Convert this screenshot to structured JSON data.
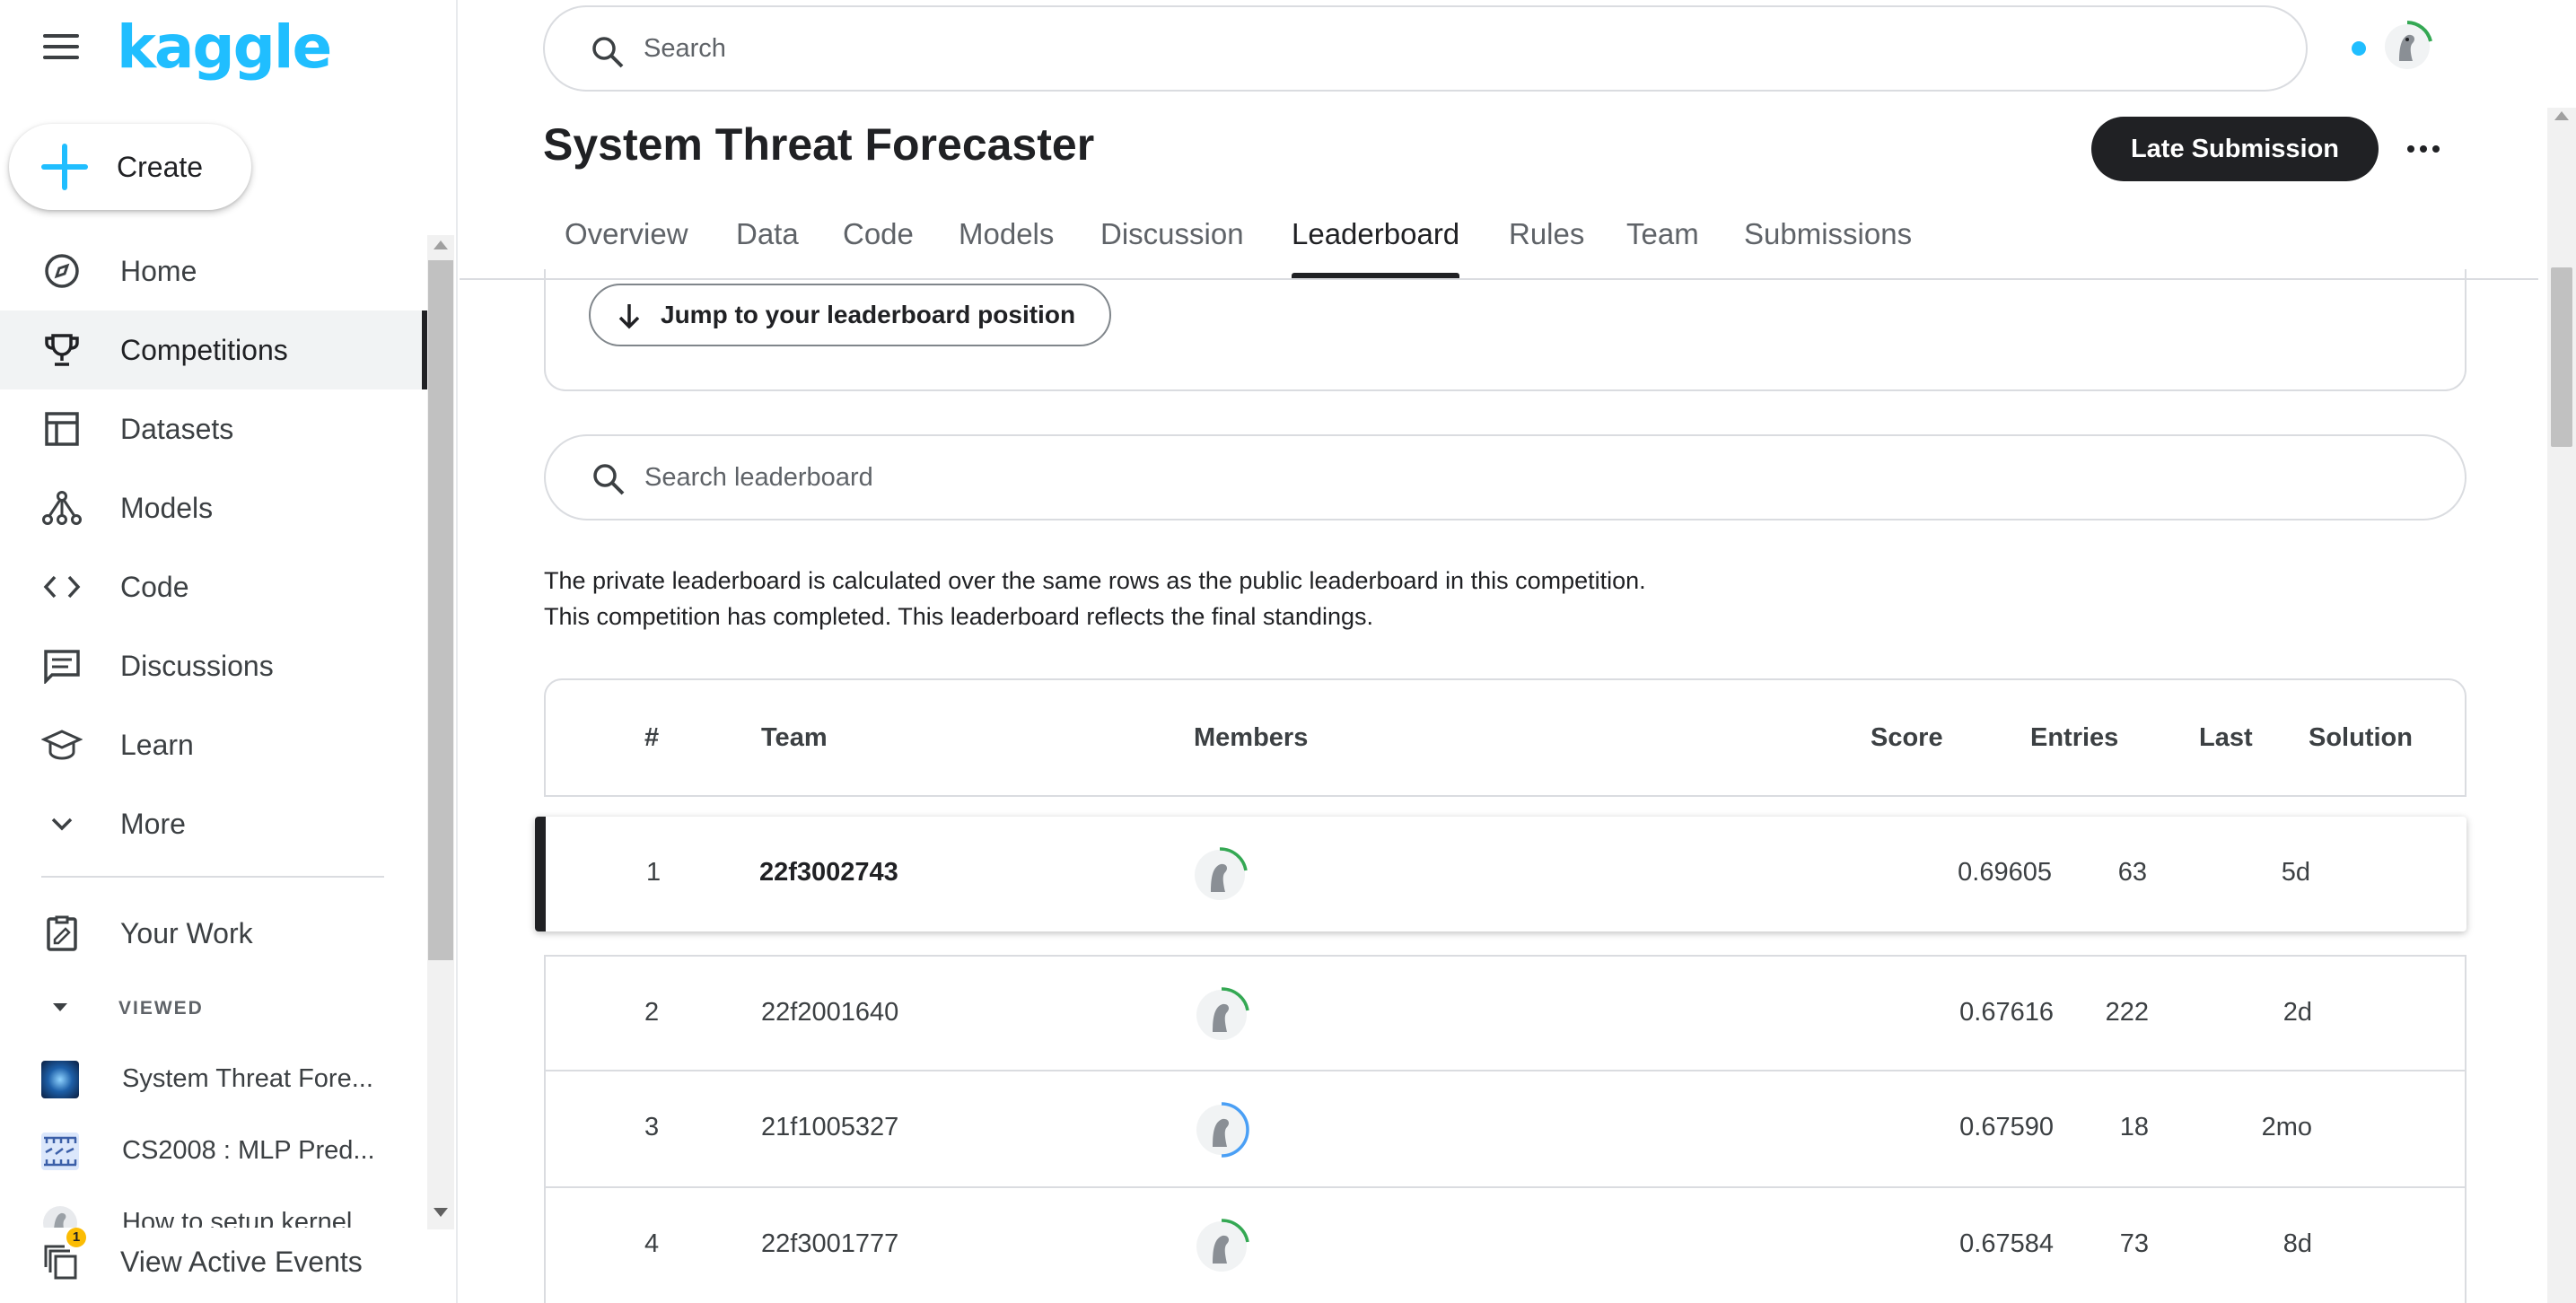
{
  "app": {
    "logo_text": "kaggle",
    "brand_color": "#20beff"
  },
  "header": {
    "search_placeholder": "Search"
  },
  "sidebar": {
    "create_label": "Create",
    "items": [
      {
        "label": "Home",
        "icon": "compass-icon"
      },
      {
        "label": "Competitions",
        "icon": "trophy-icon",
        "active": true
      },
      {
        "label": "Datasets",
        "icon": "table-icon"
      },
      {
        "label": "Models",
        "icon": "models-icon"
      },
      {
        "label": "Code",
        "icon": "code-icon"
      },
      {
        "label": "Discussions",
        "icon": "discussion-icon"
      },
      {
        "label": "Learn",
        "icon": "graduation-cap-icon"
      },
      {
        "label": "More",
        "icon": "chevron-down-icon"
      }
    ],
    "your_work_label": "Your Work",
    "viewed_label": "VIEWED",
    "viewed_items": [
      {
        "label": "System Threat Fore..."
      },
      {
        "label": "CS2008 : MLP Pred..."
      },
      {
        "label": "How to setup kernel"
      }
    ],
    "active_events_label": "View Active Events",
    "active_events_badge": "1"
  },
  "competition": {
    "title": "System Threat Forecaster",
    "late_submission_label": "Late Submission",
    "tabs": [
      {
        "label": "Overview"
      },
      {
        "label": "Data"
      },
      {
        "label": "Code"
      },
      {
        "label": "Models"
      },
      {
        "label": "Discussion"
      },
      {
        "label": "Leaderboard",
        "active": true
      },
      {
        "label": "Rules"
      },
      {
        "label": "Team"
      },
      {
        "label": "Submissions"
      }
    ]
  },
  "leaderboard": {
    "jump_label": "Jump to your leaderboard position",
    "search_placeholder": "Search leaderboard",
    "note_line1": "The private leaderboard is calculated over the same rows as the public leaderboard in this competition.",
    "note_line2": "This competition has completed. This leaderboard reflects the final standings.",
    "columns": {
      "rank": "#",
      "team": "Team",
      "members": "Members",
      "score": "Score",
      "entries": "Entries",
      "last": "Last",
      "solution": "Solution"
    },
    "rows": [
      {
        "rank": "1",
        "team": "22f3002743",
        "score": "0.69605",
        "entries": "63",
        "last": "5d",
        "ring": "green"
      },
      {
        "rank": "2",
        "team": "22f2001640",
        "score": "0.67616",
        "entries": "222",
        "last": "2d",
        "ring": "green"
      },
      {
        "rank": "3",
        "team": "21f1005327",
        "score": "0.67590",
        "entries": "18",
        "last": "2mo",
        "ring": "blue"
      },
      {
        "rank": "4",
        "team": "22f3001777",
        "score": "0.67584",
        "entries": "73",
        "last": "8d",
        "ring": "green"
      }
    ]
  }
}
